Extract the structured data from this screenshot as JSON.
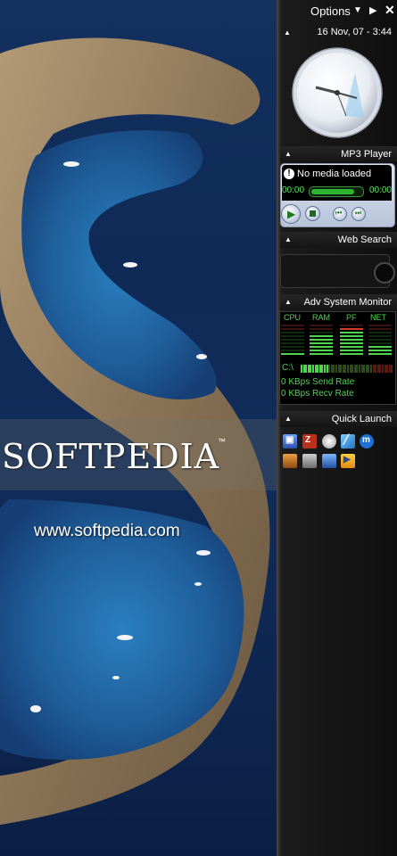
{
  "wallpaper": {
    "brand": "SOFTPEDIA",
    "trademark": "™",
    "url": "www.softpedia.com"
  },
  "sidebar": {
    "options_label": "Options",
    "clock": {
      "datetime": "16 Nov, 07 - 3:44"
    },
    "mp3": {
      "title": "MP3 Player",
      "message": "No media loaded",
      "time_elapsed": "00:00",
      "time_total": "00:00",
      "progress": 0.85
    },
    "web_search": {
      "title": "Web Search",
      "query": ""
    },
    "sysmon": {
      "title": "Adv System Monitor",
      "columns": [
        "CPU",
        "RAM",
        "PF",
        "NET"
      ],
      "levels": [
        0.15,
        0.7,
        0.85,
        0.3
      ],
      "drive_label": "C:\\",
      "drive_level": 0.3,
      "send_rate": "0 KBps Send Rate",
      "recv_rate": "0 KBps Recv Rate"
    },
    "quick_launch": {
      "title": "Quick Launch",
      "icons": [
        "my-computer-icon",
        "filezilla-icon",
        "cd-burner-icon",
        "notepad-icon",
        "maxthon-icon",
        "media-tool-icon",
        "winamp-icon",
        "desktop-icon",
        "media-player-icon"
      ]
    }
  },
  "colors": {
    "lcd_green": "#4fd44f",
    "meter_red": "#d23a2a",
    "sidebar_bg": "#111111",
    "accent_blue": "#9fb8e3"
  }
}
